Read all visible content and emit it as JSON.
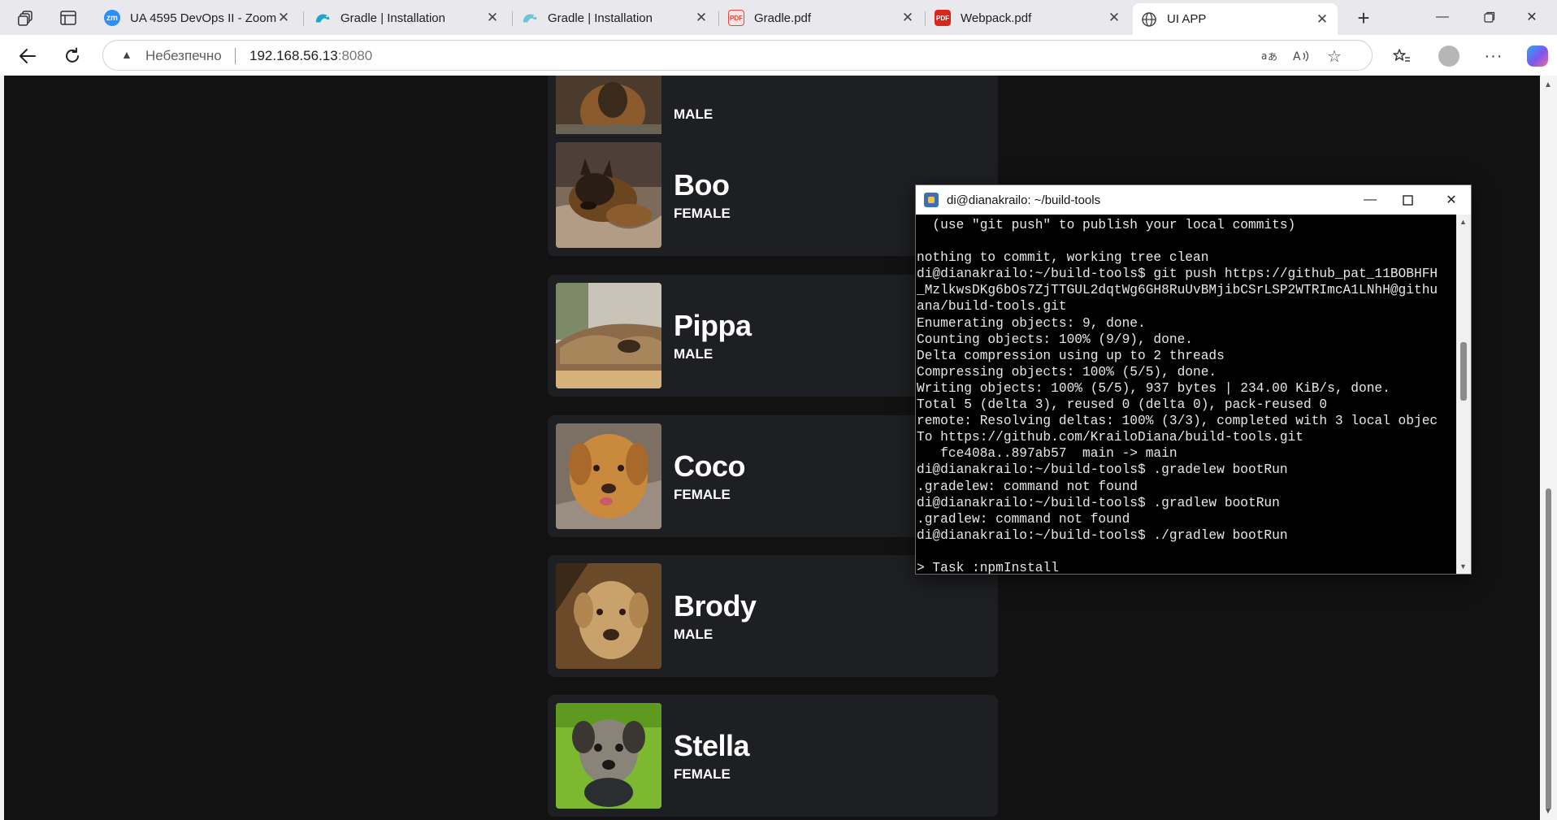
{
  "browser": {
    "tabs": [
      {
        "title": "UA 4595 DevOps II - Zoom",
        "favicon": "zoom-icon",
        "color": "#2d8cff",
        "fav_text": "zm"
      },
      {
        "title": "Gradle | Installation",
        "favicon": "gradle-icon",
        "color": "#1ba8cb"
      },
      {
        "title": "Gradle | Installation",
        "favicon": "gradle-icon",
        "color": "#1ba8cb"
      },
      {
        "title": "Gradle.pdf",
        "favicon": "pdf-icon",
        "color": "#e8463c"
      },
      {
        "title": "Webpack.pdf",
        "favicon": "pdf-icon",
        "color": "#d9261c"
      },
      {
        "title": "UI APP",
        "favicon": "globe-icon",
        "color": "#555555"
      }
    ],
    "active_tab_index": 5,
    "address": {
      "security_label": "Небезпечно",
      "host": "192.168.56.13",
      "port": ":8080"
    }
  },
  "pets": [
    {
      "name": "",
      "sex": "MALE",
      "partial": true
    },
    {
      "name": "Boo",
      "sex": "FEMALE"
    },
    {
      "name": "Pippa",
      "sex": "MALE"
    },
    {
      "name": "Coco",
      "sex": "FEMALE"
    },
    {
      "name": "Brody",
      "sex": "MALE"
    },
    {
      "name": "Stella",
      "sex": "FEMALE"
    }
  ],
  "terminal": {
    "title": "di@dianakrailo: ~/build-tools",
    "lines": [
      "  (use \"git push\" to publish your local commits)",
      "",
      "nothing to commit, working tree clean",
      "di@dianakrailo:~/build-tools$ git push https://github_pat_11BOBHFH",
      "_MzlkwsDKg6bOs7ZjTTGUL2dqtWg6GH8RuUvBMjibCSrLSP2WTRImcA1LNhH@githu",
      "ana/build-tools.git",
      "Enumerating objects: 9, done.",
      "Counting objects: 100% (9/9), done.",
      "Delta compression using up to 2 threads",
      "Compressing objects: 100% (5/5), done.",
      "Writing objects: 100% (5/5), 937 bytes | 234.00 KiB/s, done.",
      "Total 5 (delta 3), reused 0 (delta 0), pack-reused 0",
      "remote: Resolving deltas: 100% (3/3), completed with 3 local objec",
      "To https://github.com/KrailoDiana/build-tools.git",
      "   fce408a..897ab57  main -> main",
      "di@dianakrailo:~/build-tools$ .gradelew bootRun",
      ".gradelew: command not found",
      "di@dianakrailo:~/build-tools$ .gradlew bootRun",
      ".gradlew: command not found",
      "di@dianakrailo:~/build-tools$ ./gradlew bootRun",
      "",
      "> Task :npmInstall"
    ]
  }
}
